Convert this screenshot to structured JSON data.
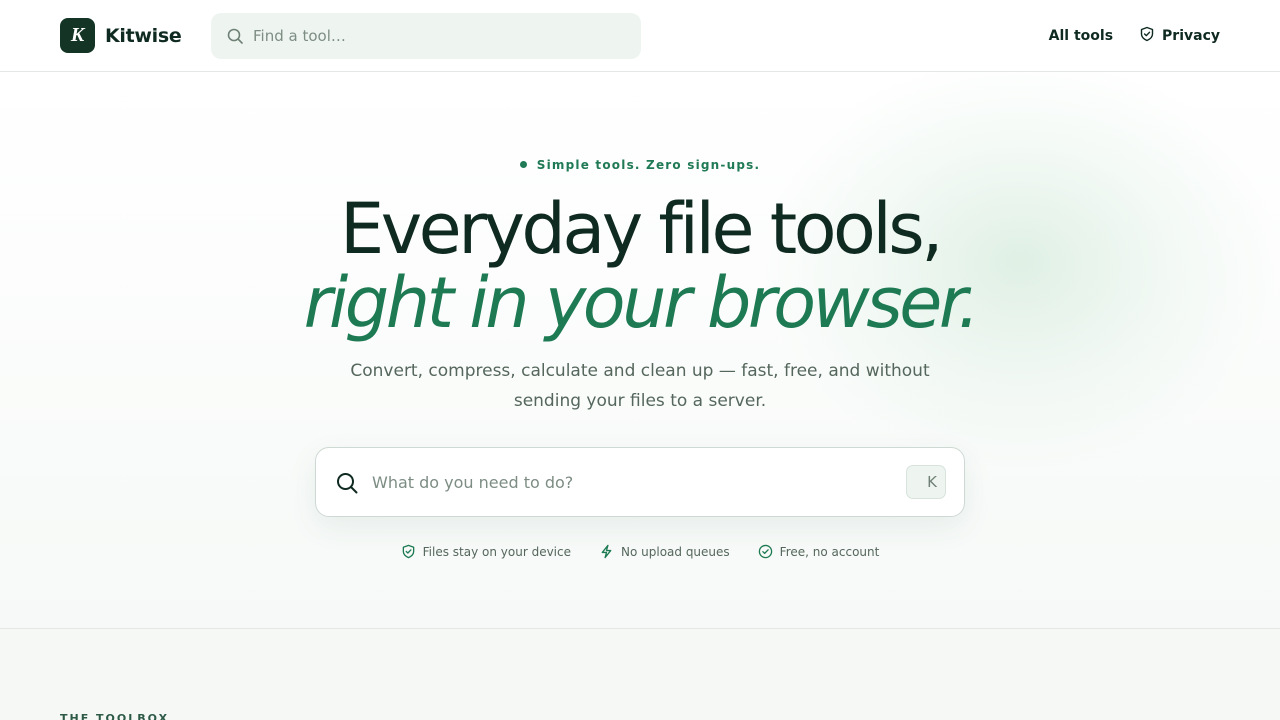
{
  "brand": {
    "logo_letter": "K",
    "name": "Kitwise"
  },
  "header": {
    "search": {
      "placeholder": "Find a tool…"
    },
    "nav": {
      "all_tools": "All tools",
      "privacy": "Privacy"
    }
  },
  "hero": {
    "eyebrow": "Simple tools. Zero sign-ups.",
    "headline_line1": "Everyday file tools,",
    "headline_line2": "right in your browser.",
    "subhead": "Convert, compress, calculate and clean up — fast, free, and without sending your files to a server.",
    "search": {
      "placeholder": "What do you need to do?",
      "shortcut": "K"
    },
    "features": [
      {
        "icon": "shield-check-icon",
        "label": "Files stay on your device"
      },
      {
        "icon": "lightning-icon",
        "label": "No upload queues"
      },
      {
        "icon": "check-circle-icon",
        "label": "Free, no account"
      }
    ]
  },
  "toolbox": {
    "label": "THE TOOLBOX"
  },
  "colors": {
    "accent": "#1d7a53",
    "dark": "#143526",
    "text": "#0f2a20",
    "muted": "#55675d"
  }
}
